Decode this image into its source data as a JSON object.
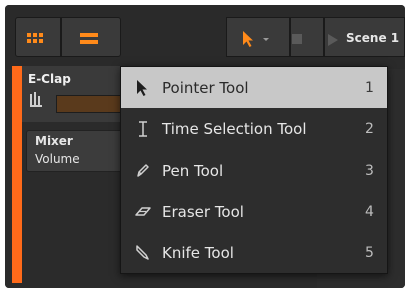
{
  "toolbar": {
    "left_icons": [
      "grid-icon",
      "lines-icon"
    ],
    "tool_icon": "pointer-icon",
    "scene_label": "Scene 1"
  },
  "track": {
    "name": "E-Clap",
    "device": {
      "title": "Mixer",
      "param": "Volume"
    }
  },
  "tool_menu": {
    "items": [
      {
        "label": "Pointer Tool",
        "shortcut": "1",
        "icon": "pointer-icon",
        "selected": true
      },
      {
        "label": "Time Selection Tool",
        "shortcut": "2",
        "icon": "text-cursor-icon",
        "selected": false
      },
      {
        "label": "Pen Tool",
        "shortcut": "3",
        "icon": "pen-icon",
        "selected": false
      },
      {
        "label": "Eraser Tool",
        "shortcut": "4",
        "icon": "eraser-icon",
        "selected": false
      },
      {
        "label": "Knife Tool",
        "shortcut": "5",
        "icon": "knife-icon",
        "selected": false
      }
    ]
  },
  "colors": {
    "accent": "#ff7a1a",
    "track_color": "#ff6a1a",
    "menu_bg": "#2d2d2d",
    "menu_selected": "#c8c8c8"
  }
}
